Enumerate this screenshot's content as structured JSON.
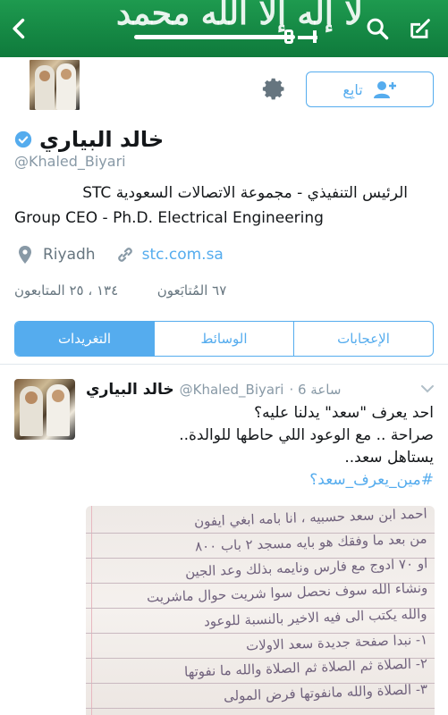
{
  "header": {
    "back_icon": "chevron-left-icon",
    "search_icon": "search-icon",
    "compose_icon": "compose-icon",
    "banner_color": "#168a45"
  },
  "profile": {
    "name": "خالد البياري",
    "handle": "@Khaled_Biyari",
    "bio_line1": "الرئيس التنفيذي - مجموعة الاتصالات السعودية STC",
    "bio_line2": "Group CEO - Ph.D. Electrical Engineering",
    "location": "Riyadh",
    "website": "stc.com.sa",
    "followers_text": "١٣٤ ، ٢٥ المتابعون",
    "following_text": "٦٧ المُتابَعون",
    "follow_label": "تابِع"
  },
  "tabs": [
    {
      "label": "الإعجابات"
    },
    {
      "label": "الوسائط"
    },
    {
      "label": "التغريدات"
    }
  ],
  "tweet": {
    "name": "خالد البياري",
    "handle": "@Khaled_Biyari",
    "time": "6 ساعة",
    "line1": "احد يعرف \"سعد\" يدلنا عليه؟",
    "line2": "صراحة .. مع الوعود اللي حاطها للوالدة..",
    "line3": "يستاهل سعد..",
    "hashtag": "#مين_يعرف_سعد؟",
    "media_lines": [
      "احمد ابن سعد حسبيه ، انا بامه ابغي ايفون",
      "من بعد ما وفقك هو بايه مسجد ٢ باب ٨٠٠",
      "او ٧٠ ادوج مع فارس ونايمه بذلك وعد الجين",
      "ونشاء الله سوف نحصل سوا شريت حوال ماشريت",
      "والله يكتب الى فيه الاخير بالنسبة للوعود",
      "١- نبدا صفحة جديدة سعد الاولات",
      "٢- الصلاة ثم الصلاة ثم الصلاة والله ما نفوتها",
      "٣- الصلاة والله مانفوتها فرض المولى"
    ]
  },
  "colors": {
    "accent": "#55acee",
    "muted": "#8899a6"
  }
}
